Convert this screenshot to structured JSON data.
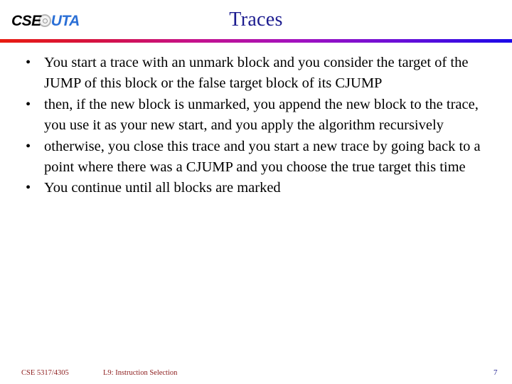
{
  "slide": {
    "title": "Traces",
    "logo": {
      "prefix": "CSE",
      "at_symbol": "at-symbol",
      "suffix": "UTA",
      "prefix_color": "#000000",
      "suffix_color": "#2a6fd6"
    },
    "divider": {
      "gradient_start": "#e81c10",
      "gradient_mid": "#c5118c",
      "gradient_end": "#1a09e8"
    },
    "bullets": [
      {
        "marker": "•",
        "text": "You start a trace with an unmark block and you consider the target of the JUMP of this block or the false target block of its CJUMP"
      },
      {
        "marker": "•",
        "text": "then, if the new block is unmarked, you append the new block to the trace, you use it as your new start, and you apply the algorithm recursively"
      },
      {
        "marker": "•",
        "text": "otherwise, you close this trace and you start a new trace by going back to a point where there was a CJUMP and you choose the true target this time"
      },
      {
        "marker": "•",
        "text": "You continue until all blocks are marked"
      }
    ],
    "footer": {
      "course": "CSE 5317/4305",
      "lecture": "L9: Instruction Selection",
      "page_number": "7",
      "text_color": "#8b1a1a",
      "page_color": "#1b1b8f"
    }
  }
}
